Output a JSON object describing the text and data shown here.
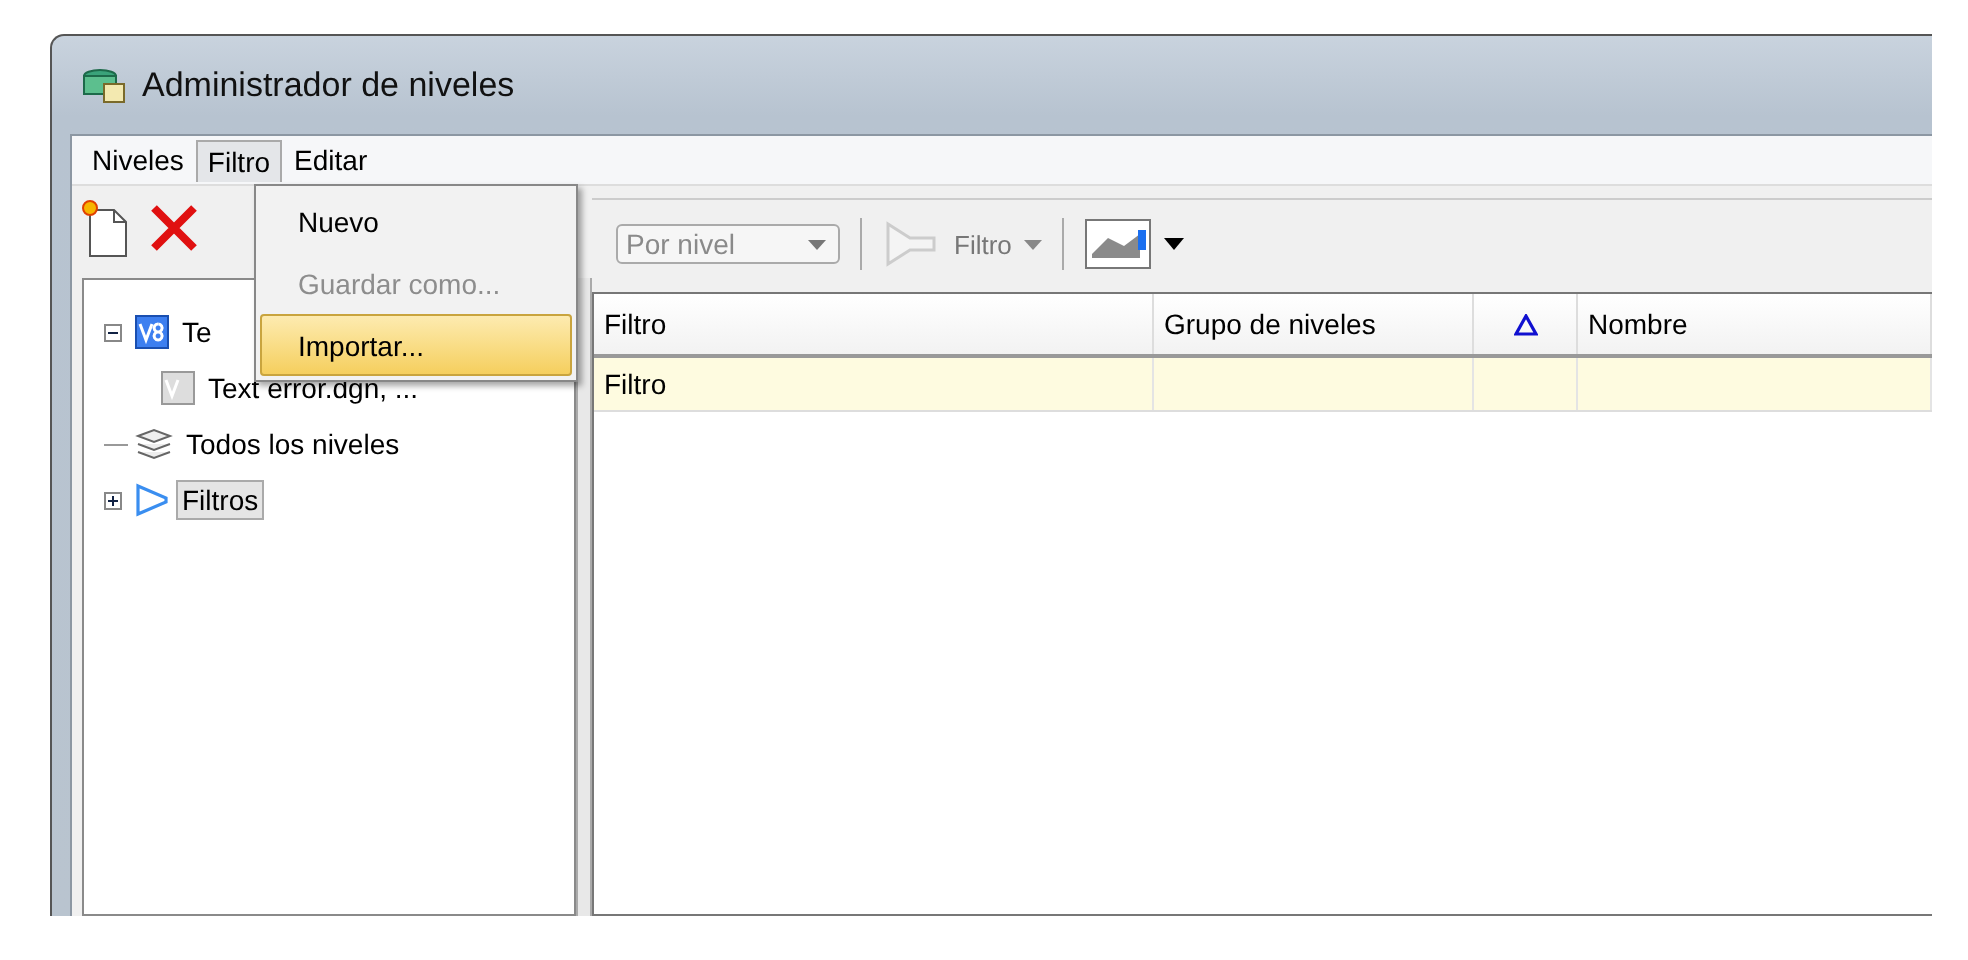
{
  "window": {
    "title": "Administrador de niveles"
  },
  "menu_bar": [
    {
      "label": "Niveles",
      "selected": false
    },
    {
      "label": "Filtro",
      "selected": true
    },
    {
      "label": "Editar",
      "selected": false
    }
  ],
  "open_menu": [
    {
      "label": "Nuevo",
      "disabled": false,
      "selected": false
    },
    {
      "label": "Guardar como...",
      "disabled": true,
      "selected": false
    },
    {
      "label": "Importar...",
      "disabled": false,
      "selected": true
    }
  ],
  "tree": [
    {
      "label": "Te",
      "kind": "file",
      "expanded": true,
      "selected": false,
      "children": [
        {
          "label": "Text error.dgn, ...",
          "kind": "reference",
          "selected": false
        }
      ]
    },
    {
      "label": "Todos los niveles",
      "kind": "levels",
      "selected": false
    },
    {
      "label": "Filtros",
      "kind": "filter",
      "expanded": false,
      "selected": true
    }
  ],
  "toolbar": {
    "combo": {
      "value": "Por nivel",
      "disabled": true
    },
    "filter_button": {
      "label": "Filtro",
      "disabled": true
    }
  },
  "table": {
    "columns": [
      {
        "label": "Filtro",
        "kind": "text"
      },
      {
        "label": "Grupo de niveles",
        "kind": "text"
      },
      {
        "kind": "delta"
      },
      {
        "label": "Nombre",
        "kind": "text"
      }
    ],
    "rows": [
      {
        "selected": true,
        "cells": [
          "Filtro",
          "",
          "",
          ""
        ]
      }
    ]
  }
}
